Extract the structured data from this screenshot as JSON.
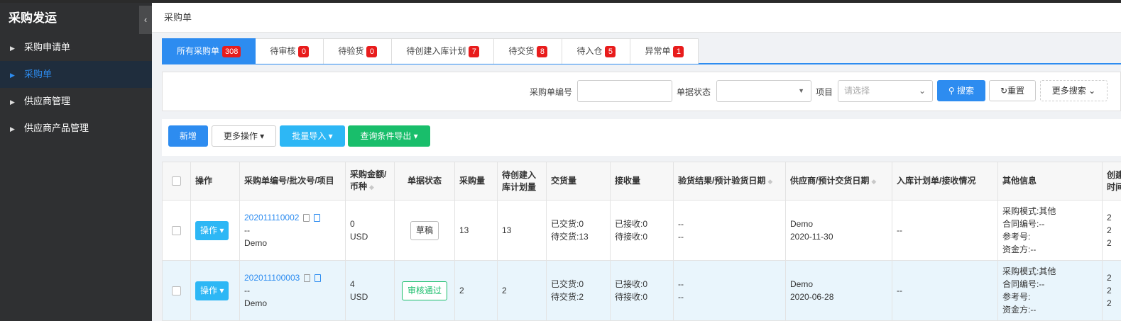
{
  "sidebar": {
    "title": "采购发运",
    "collapse_icon": "‹",
    "items": [
      {
        "label": "采购申请单",
        "active": false
      },
      {
        "label": "采购单",
        "active": true
      },
      {
        "label": "供应商管理",
        "active": false
      },
      {
        "label": "供应商产品管理",
        "active": false
      }
    ]
  },
  "breadcrumb": "采购单",
  "tabs": [
    {
      "label": "所有采购单",
      "count": "308",
      "active": true
    },
    {
      "label": "待审核",
      "count": "0"
    },
    {
      "label": "待验货",
      "count": "0"
    },
    {
      "label": "待创建入库计划",
      "count": "7"
    },
    {
      "label": "待交货",
      "count": "8"
    },
    {
      "label": "待入仓",
      "count": "5"
    },
    {
      "label": "异常单",
      "count": "1"
    }
  ],
  "search": {
    "po_number_label": "采购单编号",
    "po_number_value": "",
    "status_label": "单据状态",
    "status_value": "",
    "project_label": "项目",
    "project_placeholder": "请选择",
    "search_button": "搜索",
    "reset_button": "重置",
    "more_search_button": "更多搜索"
  },
  "toolbar": {
    "new_button": "新增",
    "more_ops_button": "更多操作",
    "batch_import_button": "批量导入",
    "export_button": "查询条件导出"
  },
  "table": {
    "headers": {
      "ops": "操作",
      "po": "采购单编号/批次号/项目",
      "amount": "采购金额/币种",
      "status": "单据状态",
      "qty": "采购量",
      "pending_plan": "待创建入库计划量",
      "delivery": "交货量",
      "received": "接收量",
      "inspection": "验货结果/预计验货日期",
      "supplier": "供应商/预计交货日期",
      "inbound": "入库计划单/接收情况",
      "other": "其他信息",
      "extra": "创建人/时间"
    },
    "rows": [
      {
        "op_label": "操作",
        "po_number": "202011110002",
        "batch": "--",
        "project": "Demo",
        "amount": "0",
        "currency": "USD",
        "status": "草稿",
        "qty": "13",
        "pending_plan": "13",
        "delivered": "已交货:0",
        "to_deliver": "待交货:13",
        "received": "已接收:0",
        "to_receive": "待接收:0",
        "inspection_result": "--",
        "inspection_date": "--",
        "supplier": "Demo",
        "delivery_date": "2020-11-30",
        "inbound": "--",
        "purchase_mode": "采购模式:其他",
        "contract_no": "合同编号:--",
        "ref_no": "参考号:",
        "funder": "资金方:--",
        "extra_1": "2",
        "extra_2": "2",
        "extra_3": "2"
      },
      {
        "op_label": "操作",
        "po_number": "202011100003",
        "batch": "--",
        "project": "Demo",
        "amount": "4",
        "currency": "USD",
        "status": "审核通过",
        "qty": "2",
        "pending_plan": "2",
        "delivered": "已交货:0",
        "to_deliver": "待交货:2",
        "received": "已接收:0",
        "to_receive": "待接收:0",
        "inspection_result": "--",
        "inspection_date": "--",
        "supplier": "Demo",
        "delivery_date": "2020-06-28",
        "inbound": "--",
        "purchase_mode": "采购模式:其他",
        "contract_no": "合同编号:--",
        "ref_no": "参考号:",
        "funder": "资金方:--",
        "extra_1": "2",
        "extra_2": "2",
        "extra_3": "2"
      }
    ]
  },
  "colors": {
    "primary": "#2d8cf0",
    "info": "#2db7f5",
    "success": "#19be6b",
    "danger": "#e81c1c",
    "sidebar_bg": "#2f3032"
  }
}
